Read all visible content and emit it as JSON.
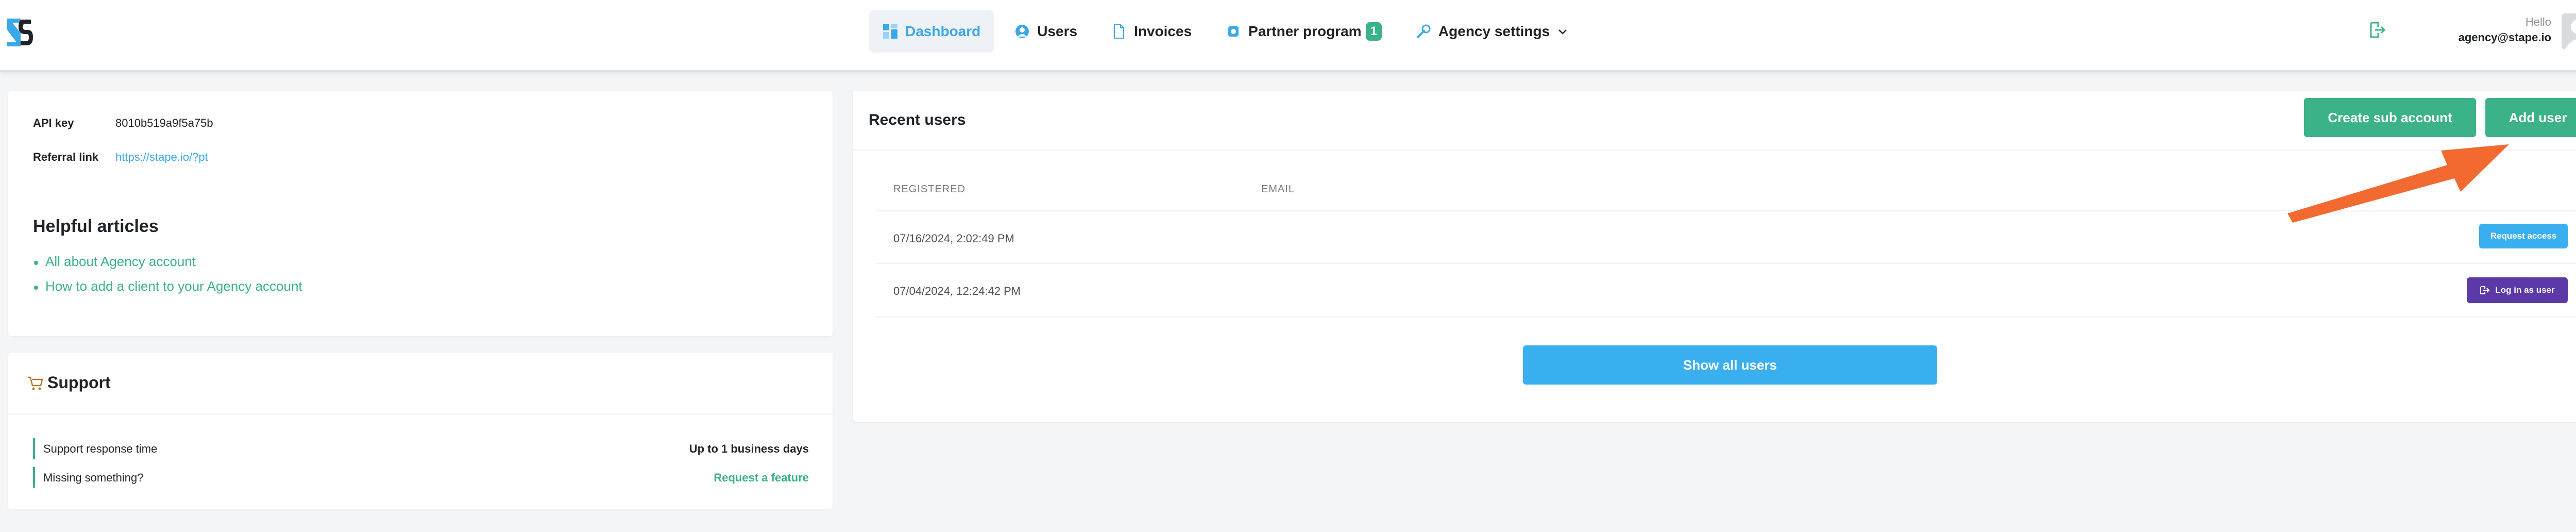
{
  "brand": {
    "logo_icon": "stape-logo-icon",
    "accent": "#3aa8e8",
    "green": "#3bb287"
  },
  "nav": {
    "items": [
      {
        "label": "Dashboard",
        "icon": "dashboard-icon",
        "active": true
      },
      {
        "label": "Users",
        "icon": "users-icon",
        "active": false
      },
      {
        "label": "Invoices",
        "icon": "invoice-icon",
        "active": false
      },
      {
        "label": "Partner program",
        "icon": "partner-icon",
        "active": false,
        "badge": "1"
      },
      {
        "label": "Agency settings",
        "icon": "wrench-icon",
        "active": false,
        "dropdown": true
      }
    ]
  },
  "user": {
    "greeting": "Hello",
    "email": "agency@stape.io",
    "avatar_icon": "avatar-icon",
    "logout_icon": "logout-icon"
  },
  "info_card": {
    "api_key_label": "API key",
    "api_key_value": "8010b519a9f5a75b",
    "referral_label": "Referral link",
    "referral_value": "https://stape.io/?pt",
    "articles_title": "Helpful articles",
    "articles": [
      "All about Agency account",
      "How to add a client to your Agency account"
    ]
  },
  "support_card": {
    "title": "Support",
    "title_icon": "cart-icon",
    "rows": [
      {
        "label": "Support response time",
        "value": "Up to 1 business days"
      },
      {
        "label": "Missing something?",
        "value": "Request a feature"
      }
    ]
  },
  "recent_users": {
    "title": "Recent users",
    "create_sub_account_label": "Create sub account",
    "add_user_label": "Add user",
    "columns": [
      "REGISTERED",
      "EMAIL"
    ],
    "rows": [
      {
        "registered": "07/16/2024, 2:02:49 PM",
        "email": "",
        "action": "Request access"
      },
      {
        "registered": "07/04/2024, 12:24:42 PM",
        "email": "",
        "action": "Log in as user"
      }
    ],
    "show_all_label": "Show all users"
  }
}
